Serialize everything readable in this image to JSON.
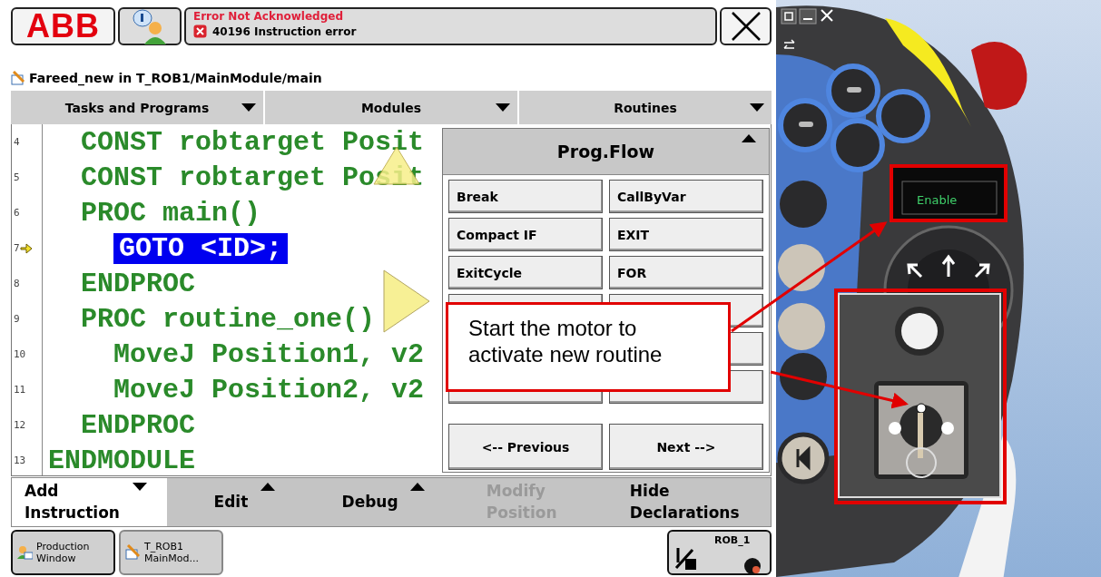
{
  "header": {
    "logo": "ABB",
    "alert_title": "Error Not Acknowledged",
    "alert_message": "40196 Instruction error"
  },
  "document_title": "Fareed_new in T_ROB1/MainModule/main",
  "menu_bar": [
    {
      "label": "Tasks and Programs"
    },
    {
      "label": "Modules"
    },
    {
      "label": "Routines"
    }
  ],
  "code_lines": [
    {
      "number": "4",
      "text": "  CONST robtarget Posit",
      "selected": false,
      "current": false
    },
    {
      "number": "5",
      "text": "  CONST robtarget Posit",
      "selected": false,
      "current": false
    },
    {
      "number": "6",
      "text": "  PROC main()",
      "selected": false,
      "current": false
    },
    {
      "number": "7",
      "text": "    GOTO <ID>;",
      "selected": true,
      "current": true
    },
    {
      "number": "8",
      "text": "  ENDPROC",
      "selected": false,
      "current": false
    },
    {
      "number": "9",
      "text": "  PROC routine_one()",
      "selected": false,
      "current": false
    },
    {
      "number": "10",
      "text": "    MoveJ Position1, v2",
      "selected": false,
      "current": false
    },
    {
      "number": "11",
      "text": "    MoveJ Position2, v2",
      "selected": false,
      "current": false
    },
    {
      "number": "12",
      "text": "  ENDPROC",
      "selected": false,
      "current": false
    },
    {
      "number": "13",
      "text": "ENDMODULE",
      "selected": false,
      "current": false
    }
  ],
  "instruction_panel": {
    "title": "Prog.Flow",
    "buttons": [
      "Break",
      "CallByVar",
      "Compact IF",
      "EXIT",
      "ExitCycle",
      "FOR"
    ],
    "previous": "<-- Previous",
    "next": "Next -->"
  },
  "command_bar": [
    {
      "label": "Add\nInstruction",
      "kind": "dropdown",
      "selected": true,
      "disabled": false
    },
    {
      "label": "Edit",
      "kind": "popup",
      "selected": false,
      "disabled": false
    },
    {
      "label": "Debug",
      "kind": "popup",
      "selected": false,
      "disabled": false
    },
    {
      "label": "Modify\nPosition",
      "kind": "plain",
      "selected": false,
      "disabled": true
    },
    {
      "label": "Hide\nDeclarations",
      "kind": "plain",
      "selected": false,
      "disabled": false
    }
  ],
  "taskbar": [
    {
      "label": "Production\nWindow",
      "kind": "production",
      "selected": true
    },
    {
      "label": "T_ROB1\nMainMod...",
      "kind": "program",
      "selected": false
    }
  ],
  "quickset": {
    "label": "ROB_1"
  },
  "pendant": {
    "enable_label": "Enable"
  },
  "callout": {
    "text": "Start the motor to activate new routine"
  }
}
